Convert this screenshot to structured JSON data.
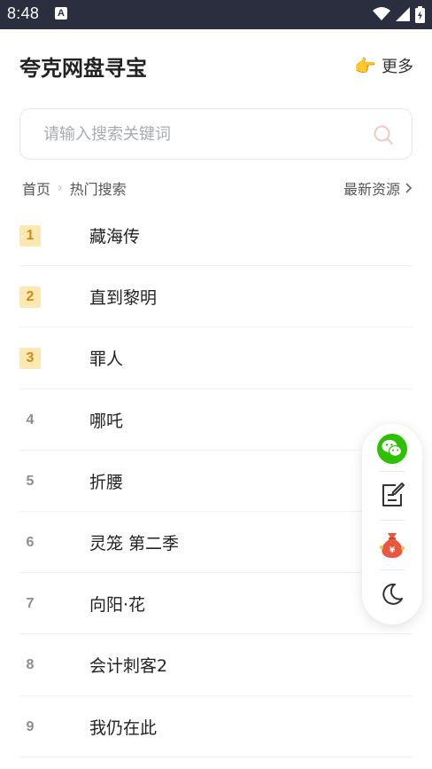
{
  "status_bar": {
    "time": "8:48",
    "badge": "A"
  },
  "header": {
    "title": "夸克网盘寻宝",
    "more_label": "更多",
    "more_icon": "pointing-hand-icon"
  },
  "search": {
    "placeholder": "请输入搜索关键词",
    "value": ""
  },
  "breadcrumb": {
    "home": "首页",
    "current": "热门搜索",
    "latest_label": "最新资源"
  },
  "hot_list": [
    {
      "rank": "1",
      "name": "藏海传"
    },
    {
      "rank": "2",
      "name": "直到黎明"
    },
    {
      "rank": "3",
      "name": "罪人"
    },
    {
      "rank": "4",
      "name": "哪吒"
    },
    {
      "rank": "5",
      "name": "折腰"
    },
    {
      "rank": "6",
      "name": "灵笼 第二季"
    },
    {
      "rank": "7",
      "name": "向阳·花"
    },
    {
      "rank": "8",
      "name": "会计刺客2"
    },
    {
      "rank": "9",
      "name": "我仍在此"
    }
  ],
  "float_menu": [
    "wechat-icon",
    "edit-note-icon",
    "money-bag-icon",
    "dark-mode-icon"
  ],
  "colors": {
    "status_bar": "#2a2e3f",
    "top_rank_bg": "#fce8b2",
    "top_rank_text": "#d08a12",
    "wechat": "#2dc100",
    "money_bag": "#e8573f"
  }
}
